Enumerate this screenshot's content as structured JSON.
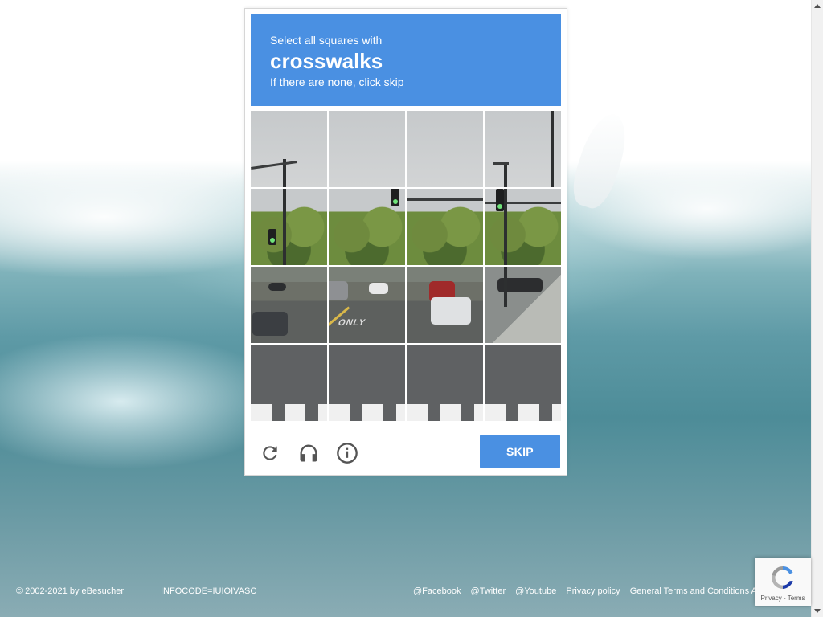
{
  "captcha": {
    "instruction": "Select all squares with",
    "keyword": "crosswalks",
    "hint": "If there are none, click skip",
    "skip_label": "SKIP",
    "header_color": "#4a90e2",
    "tiles": [
      {
        "row": 1,
        "col": 1,
        "scene": "sky-streetlight"
      },
      {
        "row": 1,
        "col": 2,
        "scene": "sky"
      },
      {
        "row": 1,
        "col": 3,
        "scene": "sky"
      },
      {
        "row": 1,
        "col": 4,
        "scene": "sky-streetlight"
      },
      {
        "row": 2,
        "col": 1,
        "scene": "trees-signal"
      },
      {
        "row": 2,
        "col": 2,
        "scene": "trees-signal"
      },
      {
        "row": 2,
        "col": 3,
        "scene": "trees-buildings"
      },
      {
        "row": 2,
        "col": 4,
        "scene": "trees-signal"
      },
      {
        "row": 3,
        "col": 1,
        "scene": "road-cars"
      },
      {
        "row": 3,
        "col": 2,
        "scene": "road-only-marking"
      },
      {
        "row": 3,
        "col": 3,
        "scene": "road-car"
      },
      {
        "row": 3,
        "col": 4,
        "scene": "sidewalk"
      },
      {
        "row": 4,
        "col": 1,
        "scene": "crosswalk"
      },
      {
        "row": 4,
        "col": 2,
        "scene": "crosswalk"
      },
      {
        "row": 4,
        "col": 3,
        "scene": "crosswalk"
      },
      {
        "row": 4,
        "col": 4,
        "scene": "crosswalk"
      }
    ],
    "road_marking": "ONLY",
    "tools": [
      "reload-icon",
      "audio-headphones-icon",
      "info-icon"
    ]
  },
  "footer": {
    "copyright": "© 2002-2021 by eBesucher",
    "infocode": "INFOCODE=IUIOIVASC",
    "links": [
      "@Facebook",
      "@Twitter",
      "@Youtube",
      "Privacy policy",
      "General Terms and Conditions Ad"
    ]
  },
  "recaptcha_badge": {
    "links": "Privacy - Terms"
  }
}
